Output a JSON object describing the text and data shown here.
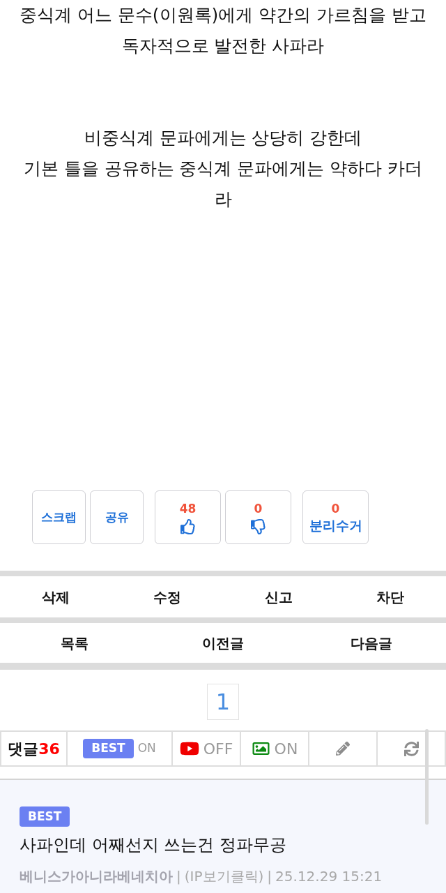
{
  "post": {
    "paragraphs": [
      {
        "lines": [
          "중식계 어느 문수(이원록)에게 약간의 가르침을 받고",
          "독자적으로 발전한 사파라"
        ]
      },
      {
        "lines": [
          "비중식계 문파에게는 상당히 강한데",
          "기본 틀을 공유하는 중식계 문파에게는 약하다 카더라"
        ]
      }
    ]
  },
  "action_buttons": [
    {
      "buttons": [
        {
          "kind": "text",
          "label": "스크랩"
        },
        {
          "kind": "text",
          "label": "공유"
        }
      ]
    },
    {
      "buttons": [
        {
          "kind": "upvote",
          "count": "48"
        },
        {
          "kind": "downvote",
          "count": "0"
        }
      ]
    },
    {
      "buttons": [
        {
          "kind": "count_text",
          "count": "0",
          "label": "분리수거"
        }
      ]
    }
  ],
  "post_menu": [
    "삭제",
    "수정",
    "신고",
    "차단"
  ],
  "post_nav": [
    "목록",
    "이전글",
    "다음글"
  ],
  "pagination": [
    {
      "label": "1",
      "selected": true
    }
  ],
  "comment_toolbar": {
    "label": "댓글",
    "count": "36",
    "items": [
      {
        "kind": "best",
        "badge": "BEST",
        "status": "ON"
      },
      {
        "kind": "video",
        "status": "OFF"
      },
      {
        "kind": "image",
        "status": "ON"
      },
      {
        "kind": "write"
      },
      {
        "kind": "refresh"
      }
    ]
  },
  "comments": [
    {
      "badge": "BEST",
      "text": "사파인데 어째선지 쓰는건 정파무공",
      "meta": [
        {
          "kind": "author",
          "text": "베니스가아니라베네치아"
        },
        {
          "kind": "separator",
          "text": "|"
        },
        {
          "kind": "ip",
          "text": "(IP보기클릭)"
        },
        {
          "kind": "separator",
          "text": "|"
        },
        {
          "kind": "date",
          "text": "25.12.29 15:21"
        }
      ]
    }
  ]
}
